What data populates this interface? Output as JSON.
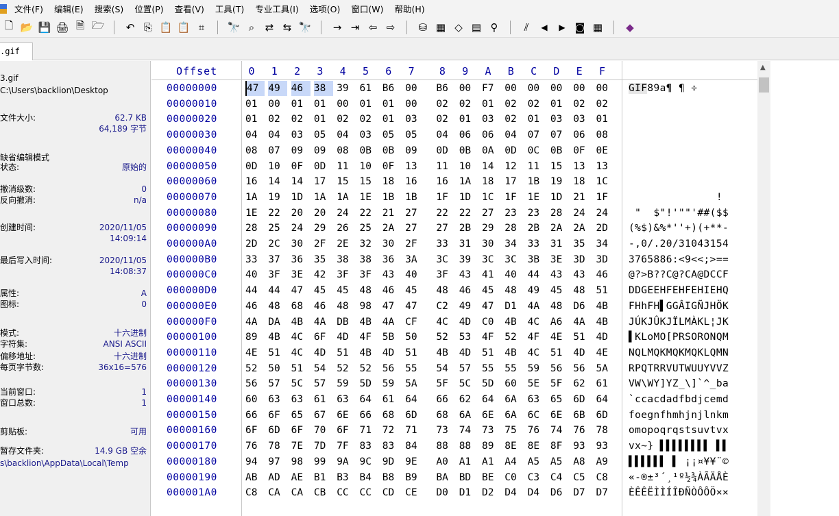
{
  "menu": [
    "文件(F)",
    "编辑(E)",
    "搜索(S)",
    "位置(P)",
    "查看(V)",
    "工具(T)",
    "专业工具(I)",
    "选项(O)",
    "窗口(W)",
    "帮助(H)"
  ],
  "toolbar": {
    "groups": [
      [
        "new-file-icon",
        "open-file-icon",
        "save-icon",
        "print-icon",
        "properties-icon",
        "open-folder-icon"
      ],
      [
        "undo-icon",
        "copy-icon",
        "paste-icon",
        "paste-special-icon",
        "copy-hex-icon"
      ],
      [
        "find-icon",
        "find-hex-icon",
        "replace-icon",
        "replace-hex-icon",
        "find-next-icon"
      ],
      [
        "goto-offset-icon",
        "goto-sector-icon",
        "back-icon",
        "forward-icon"
      ],
      [
        "disk-icon",
        "ram-icon",
        "file-compare-icon",
        "calculator-icon",
        "search-disk-icon"
      ],
      [
        "analysis-icon",
        "prev-icon",
        "next-icon",
        "camera-icon",
        "table-icon"
      ],
      [
        "diamond-icon"
      ]
    ]
  },
  "tab": {
    "label": ".gif"
  },
  "info": {
    "file_name": "3.gif",
    "path": "C:\\Users\\backlion\\Desktop",
    "size_label": "文件大小:",
    "size_value": "62.7 KB",
    "size_bytes": "64,189 字节",
    "edit_mode_label": "缺省编辑模式",
    "state_label": "状态:",
    "state_value": "原始的",
    "undo_level_label": "撤消级数:",
    "undo_level_value": "0",
    "redo_label": "反向撤消:",
    "redo_value": "n/a",
    "created_label": "创建时间:",
    "created_date": "2020/11/05",
    "created_time": "14:09:14",
    "modified_label": "最后写入时间:",
    "modified_date": "2020/11/05",
    "modified_time": "14:08:37",
    "attr_label": "属性:",
    "attr_value": "A",
    "icon_label": "图标:",
    "icon_value": "0",
    "mode_label": "模式:",
    "mode_value": "十六进制",
    "charset_label": "字符集:",
    "charset_value": "ANSI ASCII",
    "offset_label": "偏移地址:",
    "offset_value": "十六进制",
    "bytes_per_page_label": "每页字节数:",
    "bytes_per_page_value": "36x16=576",
    "current_window_label": "当前窗口:",
    "current_window_value": "1",
    "total_windows_label": "窗口总数:",
    "total_windows_value": "1",
    "clipboard_label": "剪贴板:",
    "clipboard_value": "可用",
    "temp_label": "暂存文件夹:",
    "temp_value": "14.9 GB 空余",
    "temp_path": "s\\backlion\\AppData\\Local\\Temp"
  },
  "hex": {
    "offset_header": "Offset",
    "columns": [
      "0",
      "1",
      "2",
      "3",
      "4",
      "5",
      "6",
      "7",
      "8",
      "9",
      "A",
      "B",
      "C",
      "D",
      "E",
      "F"
    ],
    "rows": [
      {
        "addr": "00000000",
        "bytes": [
          "47",
          "49",
          "46",
          "38",
          "39",
          "61",
          "B6",
          "00",
          "B6",
          "00",
          "F7",
          "00",
          "00",
          "00",
          "00",
          "00"
        ],
        "text": "GIF89a¶ ¶ ÷"
      },
      {
        "addr": "00000010",
        "bytes": [
          "01",
          "00",
          "01",
          "01",
          "00",
          "01",
          "01",
          "00",
          "02",
          "02",
          "01",
          "02",
          "02",
          "01",
          "02",
          "02"
        ],
        "text": ""
      },
      {
        "addr": "00000020",
        "bytes": [
          "01",
          "02",
          "02",
          "01",
          "02",
          "02",
          "01",
          "03",
          "02",
          "01",
          "03",
          "02",
          "01",
          "03",
          "03",
          "01"
        ],
        "text": ""
      },
      {
        "addr": "00000030",
        "bytes": [
          "04",
          "04",
          "03",
          "05",
          "04",
          "03",
          "05",
          "05",
          "04",
          "06",
          "06",
          "04",
          "07",
          "07",
          "06",
          "08"
        ],
        "text": ""
      },
      {
        "addr": "00000040",
        "bytes": [
          "08",
          "07",
          "09",
          "09",
          "08",
          "0B",
          "0B",
          "09",
          "0D",
          "0B",
          "0A",
          "0D",
          "0C",
          "0B",
          "0F",
          "0E"
        ],
        "text": ""
      },
      {
        "addr": "00000050",
        "bytes": [
          "0D",
          "10",
          "0F",
          "0D",
          "11",
          "10",
          "0F",
          "13",
          "11",
          "10",
          "14",
          "12",
          "11",
          "15",
          "13",
          "13"
        ],
        "text": ""
      },
      {
        "addr": "00000060",
        "bytes": [
          "16",
          "14",
          "14",
          "17",
          "15",
          "15",
          "18",
          "16",
          "16",
          "1A",
          "18",
          "17",
          "1B",
          "19",
          "18",
          "1C"
        ],
        "text": ""
      },
      {
        "addr": "00000070",
        "bytes": [
          "1A",
          "19",
          "1D",
          "1A",
          "1A",
          "1E",
          "1B",
          "1B",
          "1F",
          "1D",
          "1C",
          "1F",
          "1E",
          "1D",
          "21",
          "1F"
        ],
        "text": "              !"
      },
      {
        "addr": "00000080",
        "bytes": [
          "1E",
          "22",
          "20",
          "20",
          "24",
          "22",
          "21",
          "27",
          "22",
          "22",
          "27",
          "23",
          "23",
          "28",
          "24",
          "24"
        ],
        "text": " \"  $\"!'\"\"'##($$"
      },
      {
        "addr": "00000090",
        "bytes": [
          "28",
          "25",
          "24",
          "29",
          "26",
          "25",
          "2A",
          "27",
          "27",
          "2B",
          "29",
          "28",
          "2B",
          "2A",
          "2A",
          "2D"
        ],
        "text": "(%$)&%*''+)(+**-"
      },
      {
        "addr": "000000A0",
        "bytes": [
          "2D",
          "2C",
          "30",
          "2F",
          "2E",
          "32",
          "30",
          "2F",
          "33",
          "31",
          "30",
          "34",
          "33",
          "31",
          "35",
          "34"
        ],
        "text": "-,0/.20/31043154"
      },
      {
        "addr": "000000B0",
        "bytes": [
          "33",
          "37",
          "36",
          "35",
          "38",
          "38",
          "36",
          "3A",
          "3C",
          "39",
          "3C",
          "3C",
          "3B",
          "3E",
          "3D",
          "3D"
        ],
        "text": "3765886:<9<<;>=="
      },
      {
        "addr": "000000C0",
        "bytes": [
          "40",
          "3F",
          "3E",
          "42",
          "3F",
          "3F",
          "43",
          "40",
          "3F",
          "43",
          "41",
          "40",
          "44",
          "43",
          "43",
          "46"
        ],
        "text": "@?>B??C@?CA@DCCF"
      },
      {
        "addr": "000000D0",
        "bytes": [
          "44",
          "44",
          "47",
          "45",
          "45",
          "48",
          "46",
          "45",
          "48",
          "46",
          "45",
          "48",
          "49",
          "45",
          "48",
          "51"
        ],
        "text": "DDGEEHFEHFEHIEHQ"
      },
      {
        "addr": "000000E0",
        "bytes": [
          "46",
          "48",
          "68",
          "46",
          "48",
          "98",
          "47",
          "47",
          "C2",
          "49",
          "47",
          "D1",
          "4A",
          "48",
          "D6",
          "4B"
        ],
        "text": "FHhFH▌GGÂIGÑJHÖK"
      },
      {
        "addr": "000000F0",
        "bytes": [
          "4A",
          "DA",
          "4B",
          "4A",
          "DB",
          "4B",
          "4A",
          "CF",
          "4C",
          "4D",
          "C0",
          "4B",
          "4C",
          "A6",
          "4A",
          "4B"
        ],
        "text": "JÚKJÛKJÏLMÀKL¦JK"
      },
      {
        "addr": "00000100",
        "bytes": [
          "89",
          "4B",
          "4C",
          "6F",
          "4D",
          "4F",
          "5B",
          "50",
          "52",
          "53",
          "4F",
          "52",
          "4F",
          "4E",
          "51",
          "4D"
        ],
        "text": "▌KLoMO[PRSORONQM"
      },
      {
        "addr": "00000110",
        "bytes": [
          "4E",
          "51",
          "4C",
          "4D",
          "51",
          "4B",
          "4D",
          "51",
          "4B",
          "4D",
          "51",
          "4B",
          "4C",
          "51",
          "4D",
          "4E"
        ],
        "text": "NQLMQKMQKMQKLQMN"
      },
      {
        "addr": "00000120",
        "bytes": [
          "52",
          "50",
          "51",
          "54",
          "52",
          "52",
          "56",
          "55",
          "54",
          "57",
          "55",
          "55",
          "59",
          "56",
          "56",
          "5A"
        ],
        "text": "RPQTRRVUTWUUYVVZ"
      },
      {
        "addr": "00000130",
        "bytes": [
          "56",
          "57",
          "5C",
          "57",
          "59",
          "5D",
          "59",
          "5A",
          "5F",
          "5C",
          "5D",
          "60",
          "5E",
          "5F",
          "62",
          "61"
        ],
        "text": "VW\\WY]YZ_\\]`^_ba"
      },
      {
        "addr": "00000140",
        "bytes": [
          "60",
          "63",
          "63",
          "61",
          "63",
          "64",
          "61",
          "64",
          "66",
          "62",
          "64",
          "6A",
          "63",
          "65",
          "6D",
          "64"
        ],
        "text": "`ccacdadfbdjcemd"
      },
      {
        "addr": "00000150",
        "bytes": [
          "66",
          "6F",
          "65",
          "67",
          "6E",
          "66",
          "68",
          "6D",
          "68",
          "6A",
          "6E",
          "6A",
          "6C",
          "6E",
          "6B",
          "6D"
        ],
        "text": "foegnfhmhjnjlnkm"
      },
      {
        "addr": "00000160",
        "bytes": [
          "6F",
          "6D",
          "6F",
          "70",
          "6F",
          "71",
          "72",
          "71",
          "73",
          "74",
          "73",
          "75",
          "76",
          "74",
          "76",
          "78"
        ],
        "text": "omopoqrqstsuvtvx"
      },
      {
        "addr": "00000170",
        "bytes": [
          "76",
          "78",
          "7E",
          "7D",
          "7F",
          "83",
          "83",
          "84",
          "88",
          "88",
          "89",
          "8E",
          "8E",
          "8F",
          "93",
          "93"
        ],
        "text": "vx~} ▌▌▌▌▌▌▌▌ ▌▌"
      },
      {
        "addr": "00000180",
        "bytes": [
          "94",
          "97",
          "98",
          "99",
          "9A",
          "9C",
          "9D",
          "9E",
          "A0",
          "A1",
          "A1",
          "A4",
          "A5",
          "A5",
          "A8",
          "A9"
        ],
        "text": "▌▌▌▌▌▌ ▌ ¡¡¤¥¥¨©"
      },
      {
        "addr": "00000190",
        "bytes": [
          "AB",
          "AD",
          "AE",
          "B1",
          "B3",
          "B4",
          "B8",
          "B9",
          "BA",
          "BD",
          "BE",
          "C0",
          "C3",
          "C4",
          "C5",
          "C8"
        ],
        "text": "«-®±³´¸¹º½¾ÀÃÄÅÈ"
      },
      {
        "addr": "000001A0",
        "bytes": [
          "C8",
          "CA",
          "CA",
          "CB",
          "CC",
          "CC",
          "CD",
          "CE",
          "D0",
          "D1",
          "D2",
          "D4",
          "D4",
          "D6",
          "D7",
          "D7"
        ],
        "text": "ÈÊÊËÌÌÍÎÐÑÒÔÔÖ××"
      }
    ]
  }
}
